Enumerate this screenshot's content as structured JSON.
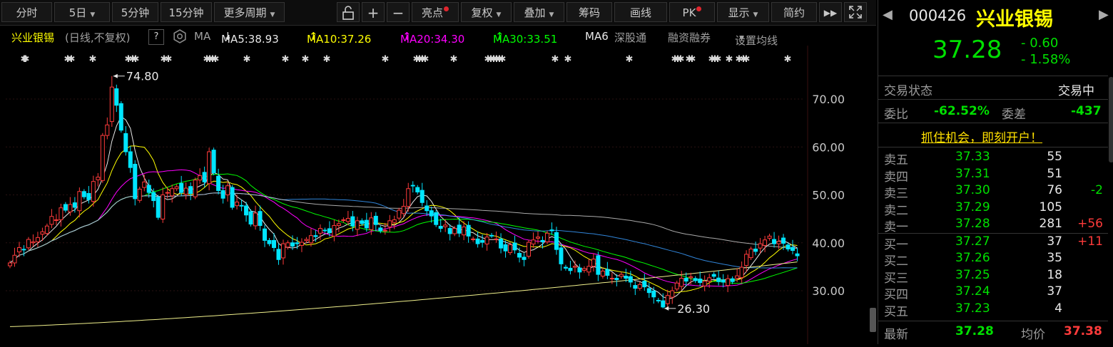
{
  "toolbar": {
    "period_tabs": [
      "分时",
      "5日",
      "5分钟",
      "15分钟",
      "更多周期"
    ],
    "icons": [
      "lock-icon",
      "plus-icon",
      "minus-icon"
    ],
    "tools": [
      "亮点",
      "复权",
      "叠加",
      "筹码",
      "画线",
      "PK",
      "显示",
      "简约"
    ],
    "end_icons": [
      "fast-forward-icon",
      "fullscreen-icon"
    ]
  },
  "infobar": {
    "stock_name": "兴业银锡",
    "mode": "(日线,不复权)",
    "help": "?",
    "ma_label": "MA",
    "ma5": "MA5:38.93",
    "ma10": "MA10:37.26",
    "ma20": "MA20:34.30",
    "ma30": "MA30:33.51",
    "ma6": "MA6",
    "shenguto": "深股通",
    "margin": "融资融券",
    "settings": "设置均线",
    "arrow_down": "↓",
    "arrow_up": "↑"
  },
  "chart_data": {
    "type": "candlestick",
    "title": "",
    "ylim": [
      22,
      82
    ],
    "yticks": [
      "70.00",
      "60.00",
      "50.00",
      "40.00",
      "30.00"
    ],
    "high_label": "74.80",
    "low_label": "26.30",
    "closes": [
      35.8,
      37.4,
      39.0,
      38.6,
      40.7,
      40.2,
      41.1,
      42.3,
      43.5,
      45.5,
      44.8,
      47.3,
      46.8,
      48.0,
      47.4,
      50.7,
      49.6,
      49.0,
      52.8,
      53.7,
      62.4,
      64.6,
      72.5,
      68.7,
      63.5,
      59.0,
      55.7,
      49.2,
      51.2,
      52.7,
      50.5,
      48.8,
      45.3,
      50.0,
      50.5,
      51.3,
      51.7,
      50.5,
      51.4,
      50.3,
      53.1,
      54.0,
      52.7,
      59.0,
      54.6,
      50.9,
      49.3,
      51.9,
      47.4,
      48.5,
      47.7,
      45.8,
      43.9,
      46.2,
      43.6,
      40.5,
      39.8,
      39.0,
      36.5,
      39.8,
      40.0,
      39.3,
      39.8,
      40.1,
      40.7,
      41.5,
      41.3,
      43.0,
      42.6,
      42.1,
      43.6,
      44.0,
      44.8,
      45.1,
      43.5,
      44.6,
      44.0,
      43.1,
      45.2,
      43.8,
      42.5,
      42.6,
      44.6,
      44.8,
      46.8,
      47.6,
      51.3,
      51.9,
      50.6,
      48.4,
      46.7,
      45.6,
      43.8,
      43.0,
      43.7,
      41.9,
      43.0,
      42.0,
      43.3,
      41.4,
      40.8,
      39.8,
      40.1,
      41.2,
      41.5,
      40.8,
      38.9,
      38.3,
      39.6,
      38.5,
      37.0,
      36.5,
      40.1,
      40.6,
      41.2,
      40.2,
      42.0,
      42.5,
      38.6,
      35.6,
      34.7,
      34.2,
      35.1,
      33.9,
      34.6,
      35.1,
      36.6,
      33.4,
      34.1,
      33.2,
      32.6,
      32.3,
      33.4,
      32.6,
      31.8,
      30.5,
      31.3,
      30.8,
      29.6,
      28.7,
      27.9,
      26.6,
      29.0,
      30.0,
      31.6,
      32.6,
      32.0,
      32.9,
      32.1,
      31.7,
      32.0,
      32.7,
      33.0,
      31.9,
      31.8,
      32.5,
      31.9,
      33.1,
      34.9,
      37.6,
      38.7,
      38.2,
      39.8,
      40.6,
      41.4,
      39.8,
      40.3,
      39.9,
      38.7,
      38.4,
      37.28
    ]
  },
  "right_panel": {
    "code": "000426",
    "name": "兴业银锡",
    "price": "37.28",
    "change": "- 0.60",
    "change_pct": "- 1.58%",
    "status_label": "交易状态",
    "status_value": "交易中",
    "weibi_label": "委比",
    "weibi_value": "-62.52%",
    "weicha_label": "委差",
    "weicha_value": "-437",
    "promo": "抓住机会，即刻开户！",
    "asks": [
      {
        "label": "卖五",
        "price": "37.33",
        "vol": "55",
        "chg": ""
      },
      {
        "label": "卖四",
        "price": "37.31",
        "vol": "51",
        "chg": ""
      },
      {
        "label": "卖三",
        "price": "37.30",
        "vol": "76",
        "chg": "-2"
      },
      {
        "label": "卖二",
        "price": "37.29",
        "vol": "105",
        "chg": ""
      },
      {
        "label": "卖一",
        "price": "37.28",
        "vol": "281",
        "chg": "+56"
      }
    ],
    "bids": [
      {
        "label": "买一",
        "price": "37.27",
        "vol": "37",
        "chg": "+11"
      },
      {
        "label": "买二",
        "price": "37.26",
        "vol": "35",
        "chg": ""
      },
      {
        "label": "买三",
        "price": "37.25",
        "vol": "18",
        "chg": ""
      },
      {
        "label": "买四",
        "price": "37.24",
        "vol": "37",
        "chg": ""
      },
      {
        "label": "买五",
        "price": "37.23",
        "vol": "4",
        "chg": ""
      }
    ],
    "latest_label": "最新",
    "latest_value": "37.28",
    "avg_label": "均价",
    "avg_value": "37.38"
  },
  "colors": {
    "up": "#ff3b3b",
    "down": "#00e5ff",
    "ma5": "#e8e8e8",
    "ma10": "#ffff00",
    "ma20": "#ff00ff",
    "ma30": "#00ff00",
    "ma60": "#3a9cff",
    "ma120": "#c8c8c8",
    "ma250": "#f0f08c",
    "price_green": "#00e000"
  }
}
